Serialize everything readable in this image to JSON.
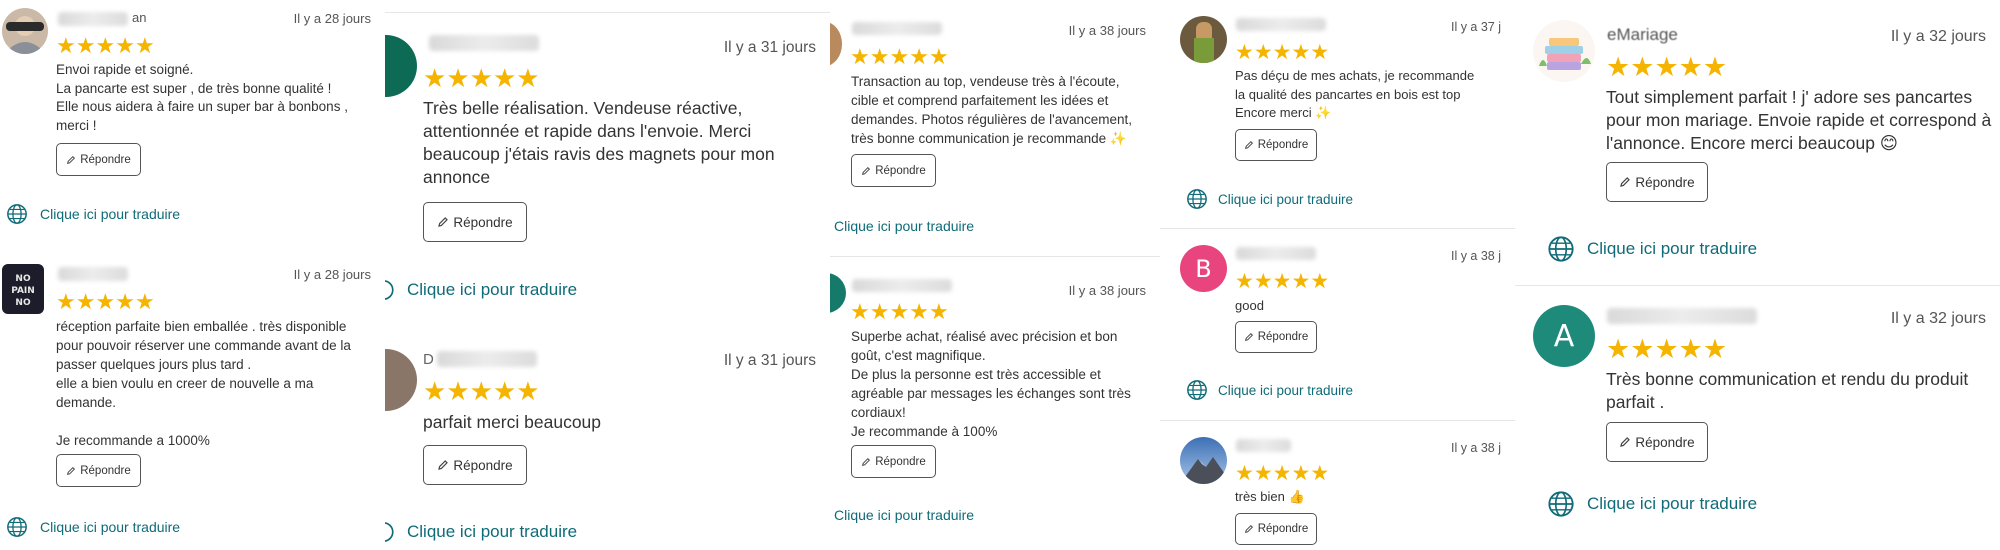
{
  "common": {
    "reply_label": "Répondre",
    "translate_label": "Clique ici pour traduire",
    "star_glyph": "★",
    "star_color": "#f4b400",
    "link_color": "#0f6b78"
  },
  "columns": [
    {
      "reviews": [
        {
          "name_visible": "an",
          "date": "Il y a 28 jours",
          "rating": 5,
          "lines": [
            "Envoi rapide et soigné.",
            "La pancarte est super , de très bonne qualité !",
            "Elle nous aidera à faire un super bar à bonbons ,",
            "merci !"
          ]
        },
        {
          "name_visible": "",
          "avatar_text": "NO PAIN NO GAIN",
          "date": "Il y a 28 jours",
          "rating": 5,
          "lines": [
            "réception parfaite bien emballée . très disponible",
            "pour pouvoir réserver une commande avant de la",
            "passer quelques jours plus tard .",
            "elle a bien voulu en creer de nouvelle a ma",
            "demande.",
            "",
            "Je recommande a 1000%"
          ]
        }
      ]
    },
    {
      "reviews": [
        {
          "date": "Il y a 31 jours",
          "rating": 5,
          "lines": [
            "Très belle réalisation. Vendeuse réactive,",
            "attentionnée et rapide dans l'envoie. Merci",
            "beaucoup j'étais ravis des magnets pour mon",
            "annonce"
          ]
        },
        {
          "name_visible": "D",
          "date": "Il y a 31 jours",
          "rating": 5,
          "lines": [
            "parfait merci beaucoup"
          ]
        }
      ]
    },
    {
      "reviews": [
        {
          "date": "Il y a 38 jours",
          "rating": 5,
          "lines": [
            "Transaction au top, vendeuse très à l'écoute,",
            "cible et comprend parfaitement les idées et",
            "demandes. Photos régulières de l'avancement,",
            "très bonne communication je recommande ✨"
          ]
        },
        {
          "date": "Il y a 38 jours",
          "rating": 5,
          "lines": [
            "Superbe achat, réalisé avec précision et bon",
            "goût, c'est magnifique.",
            "De plus la personne est très accessible et",
            "agréable par messages les échanges sont très",
            "cordiaux!",
            "Je recommande à 100%"
          ]
        }
      ]
    },
    {
      "reviews": [
        {
          "date": "Il y a 37 j",
          "rating": 5,
          "lines": [
            "Pas déçu de mes achats, je recommande",
            "la qualité des pancartes en bois est top",
            "Encore merci ✨"
          ]
        },
        {
          "avatar_letter": "B",
          "avatar_color": "#e8457e",
          "date": "Il y a 38 j",
          "rating": 5,
          "lines": [
            "good"
          ]
        },
        {
          "date": "Il y a 38 j",
          "rating": 5,
          "lines": [
            "très bien 👍"
          ]
        }
      ]
    },
    {
      "reviews": [
        {
          "name_visible": "eMariage",
          "date": "Il y a 32 jours",
          "rating": 5,
          "lines": [
            "Tout simplement parfait ! j' adore ses pancartes",
            "pour mon mariage. Envoie rapide et correspond à",
            "l'annonce. Encore merci beaucoup 😊"
          ]
        },
        {
          "avatar_letter": "A",
          "avatar_color": "#1e8a7a",
          "date": "Il y a 32 jours",
          "rating": 5,
          "lines": [
            "Très bonne communication et rendu du produit",
            "parfait ."
          ]
        }
      ]
    }
  ]
}
